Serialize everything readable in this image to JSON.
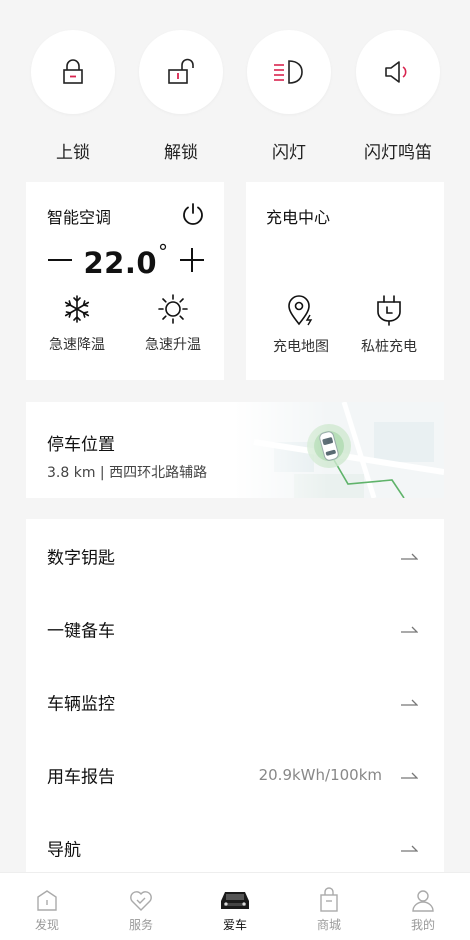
{
  "quick_actions": [
    {
      "label": "上锁",
      "icon": "lock-icon"
    },
    {
      "label": "解锁",
      "icon": "unlock-icon"
    },
    {
      "label": "闪灯",
      "icon": "headlight-icon"
    },
    {
      "label": "闪灯鸣笛",
      "icon": "horn-icon"
    }
  ],
  "climate": {
    "title": "智能空调",
    "temperature": "22.0",
    "minus": "—",
    "plus": "+",
    "cool_label": "急速降温",
    "heat_label": "急速升温"
  },
  "charging": {
    "title": "充电中心",
    "map_label": "充电地图",
    "private_label": "私桩充电"
  },
  "parking": {
    "title": "停车位置",
    "subtitle": "3.8 km | 西四环北路辅路"
  },
  "menu": [
    {
      "label": "数字钥匙",
      "value": ""
    },
    {
      "label": "一键备车",
      "value": ""
    },
    {
      "label": "车辆监控",
      "value": ""
    },
    {
      "label": "用车报告",
      "value": "20.9kWh/100km"
    },
    {
      "label": "导航",
      "value": ""
    }
  ],
  "tabs": [
    {
      "label": "发现",
      "icon": "discover-icon"
    },
    {
      "label": "服务",
      "icon": "service-heart-icon"
    },
    {
      "label": "爱车",
      "icon": "car-icon"
    },
    {
      "label": "商城",
      "icon": "shopping-bag-icon"
    },
    {
      "label": "我的",
      "icon": "profile-icon"
    }
  ],
  "active_tab": "爱车",
  "colors": {
    "accent": "#d8244f",
    "background": "#f5f5f5",
    "card": "#ffffff",
    "text": "#111111",
    "muted": "#888888"
  }
}
